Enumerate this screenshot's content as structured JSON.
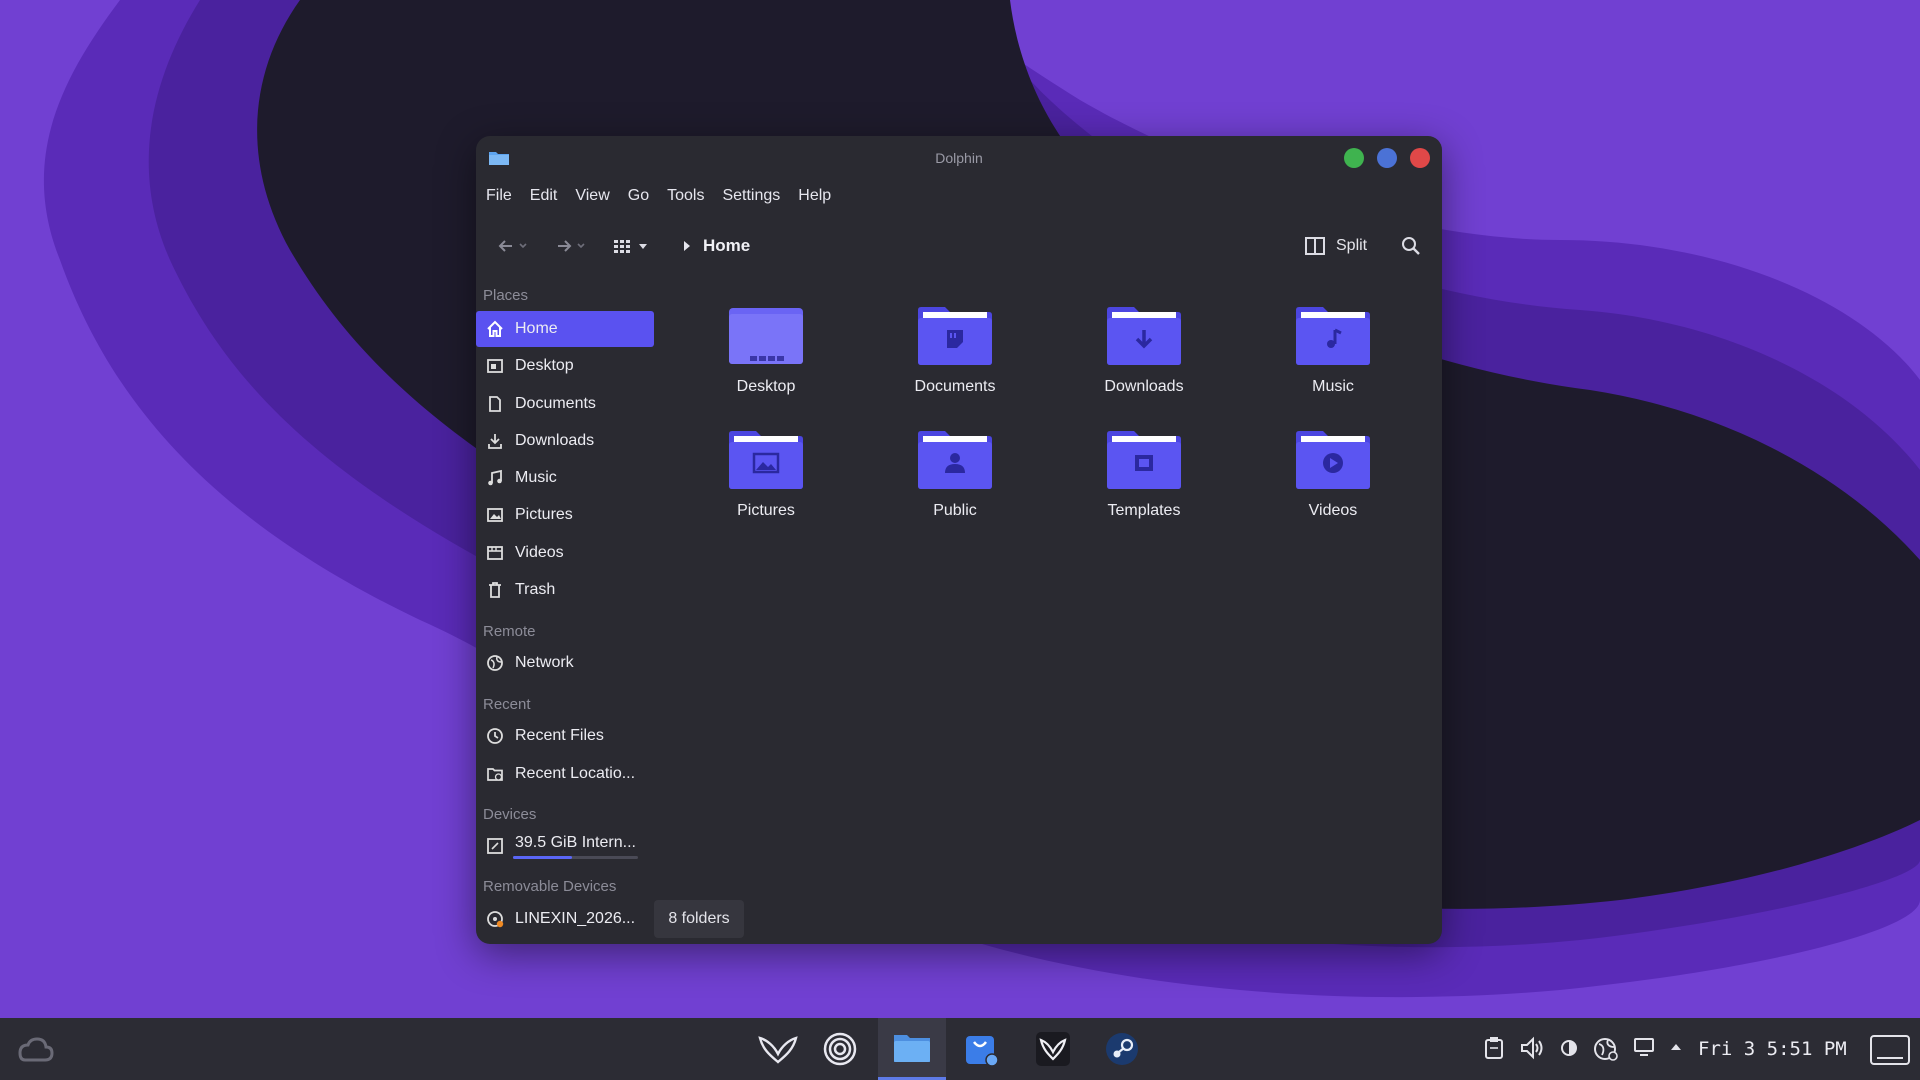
{
  "window": {
    "title": "Dolphin",
    "menu": [
      "File",
      "Edit",
      "View",
      "Go",
      "Tools",
      "Settings",
      "Help"
    ],
    "breadcrumb": "Home",
    "split_label": "Split"
  },
  "sidebar": {
    "places_title": "Places",
    "places": [
      {
        "label": "Home",
        "icon": "home-icon",
        "active": true
      },
      {
        "label": "Desktop",
        "icon": "desktop-icon"
      },
      {
        "label": "Documents",
        "icon": "document-icon"
      },
      {
        "label": "Downloads",
        "icon": "download-icon"
      },
      {
        "label": "Music",
        "icon": "music-icon"
      },
      {
        "label": "Pictures",
        "icon": "picture-icon"
      },
      {
        "label": "Videos",
        "icon": "video-icon"
      },
      {
        "label": "Trash",
        "icon": "trash-icon"
      }
    ],
    "remote_title": "Remote",
    "remote": [
      {
        "label": "Network",
        "icon": "network-icon"
      }
    ],
    "recent_title": "Recent",
    "recent": [
      {
        "label": "Recent Files",
        "icon": "clock-icon"
      },
      {
        "label": "Recent Locatio...",
        "icon": "folder-clock-icon"
      }
    ],
    "devices_title": "Devices",
    "devices": [
      {
        "label": "39.5 GiB Intern...",
        "icon": "drive-icon",
        "used_fraction": 0.47
      }
    ],
    "removable_title": "Removable Devices",
    "removable": [
      {
        "label": "LINEXIN_2026...",
        "icon": "disc-icon"
      }
    ]
  },
  "files": [
    {
      "label": "Desktop",
      "icon": "desktop-folder-icon"
    },
    {
      "label": "Documents",
      "icon": "documents-folder-icon"
    },
    {
      "label": "Downloads",
      "icon": "downloads-folder-icon"
    },
    {
      "label": "Music",
      "icon": "music-folder-icon"
    },
    {
      "label": "Pictures",
      "icon": "pictures-folder-icon"
    },
    {
      "label": "Public",
      "icon": "public-folder-icon"
    },
    {
      "label": "Templates",
      "icon": "templates-folder-icon"
    },
    {
      "label": "Videos",
      "icon": "videos-folder-icon"
    }
  ],
  "status": "8 folders",
  "taskbar": {
    "clock": "Fri 3  5:51 PM"
  },
  "colors": {
    "accent": "#5a52f0",
    "folder": "#5b55f2",
    "window_bg": "#2a2a31",
    "wallpaper_light": "#7a3fd6",
    "wallpaper_dark": "#1c1a2a"
  }
}
